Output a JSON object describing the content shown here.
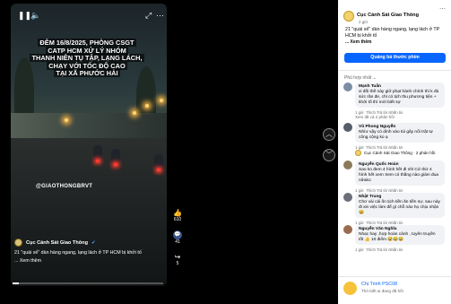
{
  "video": {
    "headline_lines": [
      "ĐÊM 16/8/2025, PHÒNG CSGT",
      "CATP HCM XỬ LÝ NHÓM",
      "THANH NIÊN TỤ TẬP, LẠNG LÁCH,",
      "CHẠY VỚI TỐC ĐỘ CAO",
      "TẠI XÃ PHƯỚC HẢI"
    ],
    "watermark": "@GIAOTHONGBRVT",
    "page_name": "Cục Cảnh Sát Giao Thông",
    "caption": "21 \"quái xế\" dàn hàng ngang, lạng lách ở TP HCM bị khởi tố",
    "see_more": "... Xem thêm",
    "progress": 0.04
  },
  "actions": {
    "like_count": "610",
    "comment_count": "41",
    "share_count": "5"
  },
  "panel": {
    "page_name": "Cục Cảnh Sát Giao Thông",
    "time": "2 giờ",
    "caption": "21 \"quái xế\" dàn hàng ngang, lạng lách ở TP HCM bị khởi tố",
    "see_more": "... Xem thêm",
    "message_button": "Quảng bá thước phim",
    "relevant_label": "Phù hợp nhất ⌄",
    "comments": [
      {
        "name": "Mạnh Tuấn",
        "text": "vi đối thế này giữ phạt hành chính thì k đủ sức răn đe, chỉ có tịch thu phương tiện + khởi tố thì mới biết sợ",
        "time": "1 giờ",
        "avatar_color": "#7a8fa6"
      },
      {
        "name": "Vũ Phong Nguyễn",
        "text": "Nhìư vậy có dính vào túi gây nổi trật tự công cộng ko ạ",
        "time": "1 giờ",
        "avatar_color": "#555e6a"
      },
      {
        "name": "Nguyễn Quốc Hoàn",
        "text": "Sao ko đem 4 hình hết đi nhỉ Cứ thử 4 hình hết xem Xem có thằng nào giám đua nữako",
        "time": "1 giờ",
        "avatar_color": "#8c7b5a"
      },
      {
        "name": "Nhật Trung",
        "text": "Chơ vài cái ốn tịch tiền ăn tiền sự, sau này đi xin việc làm để gì chỗ nào họ chịu nhận 😂",
        "time": "1 giờ",
        "avatar_color": "#6a6f7a"
      },
      {
        "name": "Nguyễn Văn Nghĩa",
        "text": "Nhạc hay ,hợp hoàn cảnh , tuyên truyền tốt 👍 10 điểm 😂😂😂",
        "time": "1 giờ",
        "avatar_color": "#9b6b4f"
      }
    ],
    "meta_actions": "Thích  Trả lời  Nhắn tin",
    "view_replies_1": "Xem tất cả 2 phản hồi",
    "page_reply": "Cục Cảnh Sát Giao Thông · 2 phản hồi",
    "bottom_name": "Chị Trinh PSC08",
    "bottom_sub": "Thỏ biết ai đang đã hồi"
  }
}
